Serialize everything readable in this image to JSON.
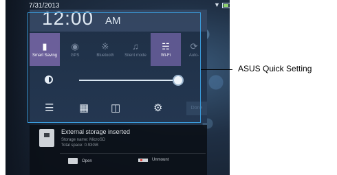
{
  "status_bar": {
    "date": "7/31/2013",
    "icons": [
      "wifi-icon",
      "battery-icon"
    ]
  },
  "clock": {
    "time": "12:00",
    "ampm": "AM"
  },
  "quick_settings": [
    {
      "label": "Smart Saving",
      "icon": "battery-leaf-icon",
      "state": "on"
    },
    {
      "label": "GPS",
      "icon": "gps-icon",
      "state": "off"
    },
    {
      "label": "Bluetooth",
      "icon": "bluetooth-icon",
      "state": "off"
    },
    {
      "label": "Silent mode",
      "icon": "silent-icon",
      "state": "off"
    },
    {
      "label": "Wi-Fi",
      "icon": "wifi-icon",
      "state": "on"
    },
    {
      "label": "Auto-",
      "icon": "auto-rotate-icon",
      "state": "off"
    }
  ],
  "brightness": {
    "icon": "brightness-icon",
    "level": 0.97
  },
  "tools": [
    {
      "icon": "wifi-settings-icon"
    },
    {
      "icon": "equalizer-icon"
    },
    {
      "icon": "screen-cast-icon"
    },
    {
      "icon": "settings-icon"
    }
  ],
  "done_button": {
    "label": "Done"
  },
  "notification": {
    "title": "External storage inserted",
    "storage_name": "Storage name: MicroSD",
    "total_space": "Total space: 0.93GB",
    "actions": [
      {
        "label": "Open",
        "icon": "folder-icon"
      },
      {
        "label": "Unmount",
        "icon": "sdcard-icon"
      }
    ]
  },
  "callout": {
    "label": "ASUS Quick Setting"
  },
  "colors": {
    "highlight": "#3a9ad9",
    "tile_on": "#6b5f9a"
  }
}
